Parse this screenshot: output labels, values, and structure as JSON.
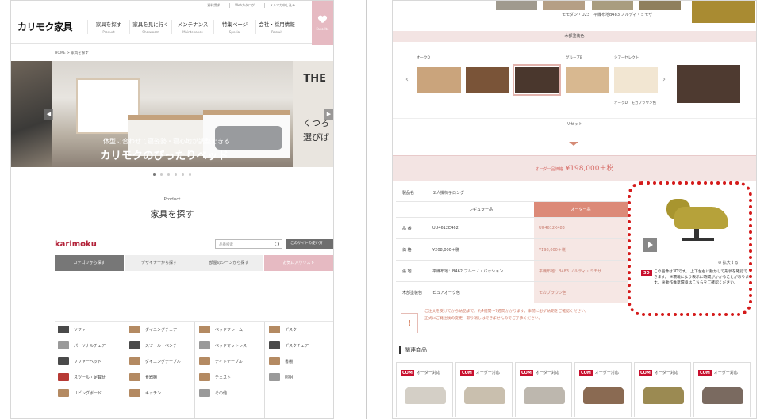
{
  "left": {
    "topbar": [
      "資料請求",
      "Webカタログ",
      "メルマガ申し込み"
    ],
    "logo": "カリモク家具",
    "nav": [
      {
        "jp": "家具を探す",
        "en": "Product"
      },
      {
        "jp": "家具を見に行く",
        "en": "Showroom"
      },
      {
        "jp": "メンテナンス",
        "en": "Maintenance"
      },
      {
        "jp": "特集ページ",
        "en": "Special"
      },
      {
        "jp": "会社・採用情報",
        "en": "Recruit"
      }
    ],
    "favorite": "Favorite",
    "breadcrumb": "HOME > 家具を探す",
    "hero": {
      "caption_small": "体型に合わせて寝姿勢・寝心地が調整できる",
      "caption_large": "カリモクのぴったりベッド",
      "ad_title": "THE",
      "ad_line1": "くつろ",
      "ad_line2": "選びば"
    },
    "section": {
      "en": "Product",
      "jp": "家具を探す"
    },
    "brand": "karimoku",
    "search_placeholder": "品番検索",
    "howto": "このサイトの使い方",
    "tabs": [
      "カテゴリから探す",
      "デザイナーから探す",
      "部屋のシーンから探す",
      "お気に入りリスト"
    ],
    "categories": [
      [
        "ソファー",
        "パーソナルチェアー",
        "ソファーベッド",
        "スツール・足載せ",
        "リビングボード"
      ],
      [
        "ダイニングチェアー",
        "スツール・ベンチ",
        "ダイニングテーブル",
        "食器棚",
        "キッチン"
      ],
      [
        "ベッドフレーム",
        "ベッドマットレス",
        "ナイトテーブル",
        "チェスト",
        "その他"
      ],
      [
        "デスク",
        "デスクチェアー",
        "書棚",
        "照明",
        ""
      ]
    ]
  },
  "right": {
    "swatch_label": "モモダン・U23　平織布地B483 ノルディ・ミモザ",
    "wood_band": "木部塗装色",
    "colors": [
      {
        "label": "オークD",
        "hex": "#caa47c"
      },
      {
        "label": "",
        "hex": "#7a5438"
      },
      {
        "label": "",
        "hex": "#4a372d"
      },
      {
        "label": "グループB",
        "hex": "#d8b890"
      },
      {
        "label": "シアーセレクト",
        "hex": "#f2e6d2"
      },
      {
        "label": "",
        "hex": "#4e3a30"
      }
    ],
    "color_caption": "オークD　モカブラウン色",
    "reset": "リセット",
    "price_label": "オーダー品価格",
    "price_value": "¥198,000＋税",
    "spec": {
      "model_key": "製品名",
      "model_value": "２人掛椅子ロング",
      "col_regular": "レギュラー品",
      "col_order": "オーダー品",
      "rows": [
        {
          "k": "品 番",
          "a": "UU4612E462",
          "b": "UU4612K483"
        },
        {
          "k": "価 格",
          "a": "¥208,000＋税",
          "b": "¥198,000＋税"
        },
        {
          "k": "張 地",
          "a": "平織布地：B462 ブルーノ・パッション",
          "b": "平織布地：B483 ノルディ・ミモザ"
        },
        {
          "k": "木部塗装色",
          "a": "ピュアオーク色",
          "b": "モカブラウン色"
        }
      ]
    },
    "preview": {
      "zoom": "拡大する",
      "badge": "3D",
      "note": "この画像は3Dです。 上下左右に動かして形状を確認できます。 ※環境により表示に時間がかかることがあります。 ※動作推奨環境はこちらをご確認ください。"
    },
    "alert": [
      "ご注文を受けてから納品まで、約4週間〜7週間かかります。事前に必ず納期をご確認ください。",
      "正式にご発注後の変更・取り消しはできませんのでご了承ください。"
    ],
    "related_title": "関連商品",
    "cards": [
      {
        "tag": "COM",
        "label": "オーダー対応"
      },
      {
        "tag": "COM",
        "label": "オーダー対応"
      },
      {
        "tag": "COM",
        "label": "オーダー対応"
      },
      {
        "tag": "COM",
        "label": "オーダー対応"
      },
      {
        "tag": "COM",
        "label": "オーダー対応"
      },
      {
        "tag": "COM",
        "label": "オーダー対応"
      }
    ]
  }
}
